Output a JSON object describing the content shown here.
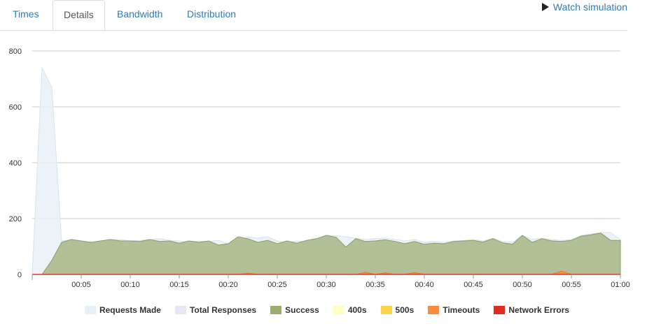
{
  "tabs": [
    {
      "label": "Times",
      "active": false
    },
    {
      "label": "Details",
      "active": true
    },
    {
      "label": "Bandwidth",
      "active": false
    },
    {
      "label": "Distribution",
      "active": false
    }
  ],
  "watch_simulation": {
    "label": "Watch simulation",
    "icon": "play-icon"
  },
  "legend": [
    {
      "label": "Requests Made",
      "color": "#e8f0f7"
    },
    {
      "label": "Total Responses",
      "color": "#ebe4f5"
    },
    {
      "label": "Success",
      "color": "#9aaf6f"
    },
    {
      "label": "400s",
      "color": "#ffffc0"
    },
    {
      "label": "500s",
      "color": "#fdd24b"
    },
    {
      "label": "Timeouts",
      "color": "#f98b3a"
    },
    {
      "label": "Network Errors",
      "color": "#e32b1d"
    }
  ],
  "chart_data": {
    "type": "area",
    "x": [
      0,
      1,
      2,
      3,
      4,
      5,
      6,
      7,
      8,
      9,
      10,
      11,
      12,
      13,
      14,
      15,
      16,
      17,
      18,
      19,
      20,
      21,
      22,
      23,
      24,
      25,
      26,
      27,
      28,
      29,
      30,
      31,
      32,
      33,
      34,
      35,
      36,
      37,
      38,
      39,
      40,
      41,
      42,
      43,
      44,
      45,
      46,
      47,
      48,
      49,
      50,
      51,
      52,
      53,
      54,
      55,
      56,
      57,
      58,
      59,
      60
    ],
    "x_ticks": [
      "00:05",
      "00:10",
      "00:15",
      "00:20",
      "00:25",
      "00:30",
      "00:35",
      "00:40",
      "00:45",
      "00:50",
      "00:55",
      "01:00"
    ],
    "x_tick_values": [
      5,
      10,
      15,
      20,
      25,
      30,
      35,
      40,
      45,
      50,
      55,
      60
    ],
    "y_ticks": [
      0,
      200,
      400,
      600,
      800
    ],
    "ylim": [
      0,
      800
    ],
    "xlim": [
      0,
      60
    ],
    "grid": true,
    "legend_position": "bottom",
    "series": [
      {
        "name": "Requests Made",
        "color": "#e8f0f7",
        "values": [
          0,
          740,
          670,
          120,
          125,
          120,
          115,
          120,
          125,
          125,
          120,
          122,
          125,
          128,
          122,
          120,
          115,
          120,
          118,
          122,
          110,
          115,
          135,
          130,
          135,
          120,
          115,
          120,
          118,
          125,
          140,
          138,
          135,
          130,
          125,
          128,
          130,
          125,
          120,
          125,
          115,
          118,
          115,
          120,
          122,
          125,
          120,
          130,
          118,
          115,
          140,
          125,
          130,
          125,
          122,
          125,
          140,
          145,
          150,
          150,
          125
        ],
        "stroke": "#d5e3ee"
      },
      {
        "name": "Total Responses",
        "color": "#ebe4f5",
        "values": [
          0,
          0,
          50,
          115,
          125,
          120,
          115,
          120,
          125,
          120,
          120,
          118,
          125,
          118,
          120,
          112,
          120,
          115,
          120,
          105,
          110,
          135,
          128,
          115,
          122,
          110,
          120,
          112,
          122,
          128,
          140,
          133,
          98,
          128,
          118,
          120,
          124,
          118,
          110,
          118,
          108,
          112,
          110,
          118,
          120,
          122,
          116,
          128,
          113,
          108,
          140,
          115,
          128,
          120,
          118,
          122,
          137,
          142,
          148,
          122,
          122
        ],
        "stroke": "#d9cfe9"
      },
      {
        "name": "Success",
        "color": "#9aaf6f",
        "values": [
          0,
          0,
          50,
          115,
          125,
          120,
          115,
          120,
          125,
          120,
          120,
          118,
          125,
          118,
          120,
          112,
          120,
          115,
          120,
          105,
          110,
          135,
          128,
          115,
          122,
          110,
          120,
          112,
          122,
          128,
          140,
          133,
          98,
          128,
          118,
          120,
          124,
          118,
          110,
          118,
          108,
          112,
          110,
          118,
          120,
          122,
          116,
          128,
          113,
          108,
          140,
          115,
          128,
          120,
          118,
          122,
          137,
          142,
          148,
          122,
          122
        ],
        "stroke": "#8aa060"
      },
      {
        "name": "400s",
        "color": "#ffffc0",
        "values": [
          0,
          0,
          0,
          0,
          0,
          0,
          0,
          0,
          0,
          0,
          0,
          0,
          0,
          0,
          0,
          0,
          0,
          0,
          0,
          0,
          0,
          0,
          0,
          0,
          0,
          0,
          0,
          0,
          0,
          0,
          0,
          0,
          0,
          0,
          0,
          0,
          0,
          0,
          0,
          0,
          0,
          0,
          0,
          0,
          0,
          0,
          0,
          0,
          0,
          0,
          0,
          0,
          0,
          0,
          0,
          0,
          0,
          0,
          0,
          0,
          0
        ],
        "stroke": "#f5e980"
      },
      {
        "name": "500s",
        "color": "#fdd24b",
        "values": [
          0,
          0,
          0,
          0,
          0,
          0,
          0,
          0,
          0,
          0,
          0,
          0,
          0,
          0,
          0,
          0,
          0,
          0,
          0,
          0,
          0,
          0,
          0,
          0,
          0,
          0,
          0,
          0,
          0,
          0,
          0,
          0,
          0,
          0,
          0,
          0,
          0,
          0,
          0,
          0,
          0,
          0,
          0,
          0,
          0,
          0,
          0,
          0,
          0,
          0,
          0,
          0,
          0,
          0,
          0,
          0,
          0,
          0,
          0,
          0,
          0
        ],
        "stroke": "#e9b82f"
      },
      {
        "name": "Timeouts",
        "color": "#f98b3a",
        "values": [
          0,
          0,
          0,
          0,
          0,
          0,
          0,
          0,
          0,
          0,
          0,
          0,
          0,
          0,
          0,
          0,
          0,
          0,
          0,
          0,
          0,
          0,
          5,
          0,
          0,
          0,
          0,
          0,
          0,
          0,
          0,
          0,
          0,
          0,
          8,
          0,
          6,
          0,
          0,
          7,
          0,
          0,
          0,
          0,
          0,
          0,
          0,
          0,
          0,
          0,
          0,
          0,
          0,
          0,
          12,
          0,
          0,
          0,
          0,
          0,
          0
        ],
        "stroke": "#f07a24"
      },
      {
        "name": "Network Errors",
        "color": "#e32b1d",
        "values": [
          0,
          0,
          0,
          0,
          0,
          0,
          0,
          0,
          0,
          0,
          0,
          0,
          0,
          0,
          0,
          0,
          0,
          0,
          0,
          0,
          0,
          0,
          0,
          0,
          0,
          0,
          0,
          0,
          0,
          0,
          0,
          0,
          0,
          0,
          0,
          0,
          0,
          0,
          0,
          0,
          0,
          0,
          0,
          0,
          0,
          0,
          0,
          0,
          0,
          0,
          0,
          0,
          0,
          0,
          0,
          0,
          0,
          0,
          0,
          0,
          0
        ],
        "stroke": "#e32b1d"
      }
    ]
  }
}
